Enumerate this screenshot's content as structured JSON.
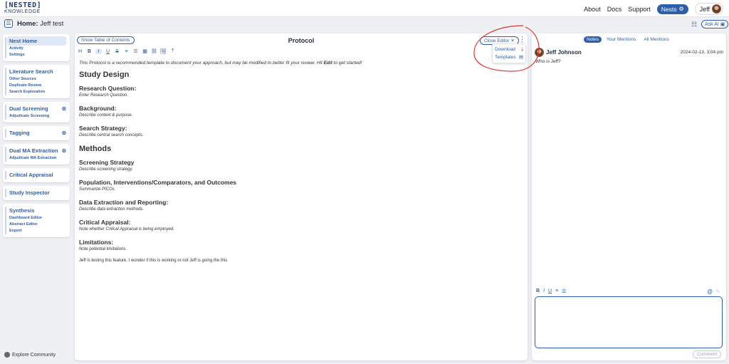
{
  "app": {
    "logo_main": "[NESTED]",
    "logo_sub": "KNOWLEDGE"
  },
  "topnav": {
    "about": "About",
    "docs": "Docs",
    "support": "Support",
    "nests": "Nests",
    "user": "Jeff"
  },
  "header": {
    "title_bold": "Home:",
    "title_rest": " Jeff test",
    "ask_ai": "Ask AI"
  },
  "sidebar": {
    "groups": [
      {
        "title": "Nest Home",
        "active": true,
        "items": [
          "Activity",
          "Settings"
        ]
      },
      {
        "title": "Literature Search",
        "items": [
          "Other Sources",
          "Duplicate Review",
          "Search Exploration"
        ]
      },
      {
        "title": "Dual Screening",
        "gear": true,
        "items": [
          "Adjudicate Screening"
        ]
      },
      {
        "title": "Tagging",
        "gear": true,
        "items": []
      },
      {
        "title": "Dual MA Extraction",
        "gear": true,
        "items": [
          "Adjudicate MA Extraction"
        ]
      },
      {
        "title": "Critical Appraisal",
        "items": []
      },
      {
        "title": "Study Inspector",
        "items": []
      },
      {
        "title": "Synthesis",
        "items": [
          "Dashboard Editor",
          "Abstract Editor",
          "Export"
        ]
      }
    ],
    "explore": "Explore Community"
  },
  "protocol": {
    "toc_button": "Show Table of Contents",
    "title": "Protocol",
    "close_editor": "Close Editor",
    "menu": {
      "download": "Download",
      "templates": "Templates"
    },
    "toolbar": [
      "H",
      "B",
      "I",
      "U",
      "S",
      "≡",
      "☰",
      "▦",
      "⛓",
      "🖼",
      "⤒"
    ],
    "intro_part1": "This Protocol is a recommended template to document your approach, but may be modified to better fit your review. Hit ",
    "intro_bold": "Edit",
    "intro_part2": " to get started!",
    "sections": [
      {
        "type": "h1",
        "text": "Study Design"
      },
      {
        "type": "h2",
        "text": "Research Question:",
        "desc": "Enter Research Question."
      },
      {
        "type": "h2",
        "text": "Background:",
        "desc": "Describe context & purpose."
      },
      {
        "type": "h2",
        "text": "Search Strategy:",
        "desc": "Describe central search concepts."
      },
      {
        "type": "h1",
        "text": "Methods"
      },
      {
        "type": "h2",
        "text": "Screening Strategy",
        "desc": "Describe screening strategy."
      },
      {
        "type": "h2",
        "text": "Population, Interventions/Comparators, and Outcomes",
        "desc": "Summarize PICOs."
      },
      {
        "type": "h2",
        "text": "Data Extraction and Reporting:",
        "desc": "Describe data extraction methods."
      },
      {
        "type": "h2",
        "text": "Critical Appraisal:",
        "desc": "Note whether Critical Appraisal is being employed."
      },
      {
        "type": "h2",
        "text": "Limitations:",
        "desc": "Note potential limitations."
      }
    ],
    "body_text": "Jeff is testing this feature, I wonder if this is working or not Jeff is going the this"
  },
  "notes": {
    "tabs": [
      "Notes",
      "Your Mentions",
      "All Mentions"
    ],
    "active_tab": 0,
    "author": "Jeff Johnson",
    "date": "2024-02-13, 3:04 pm",
    "body": "Who is Jeff?",
    "toolbar": [
      "B",
      "I",
      "U",
      "≡",
      "☰"
    ],
    "comment_button": "Comment"
  },
  "colors": {
    "accent": "#2e5ea8",
    "annotation": "#e0342c"
  }
}
